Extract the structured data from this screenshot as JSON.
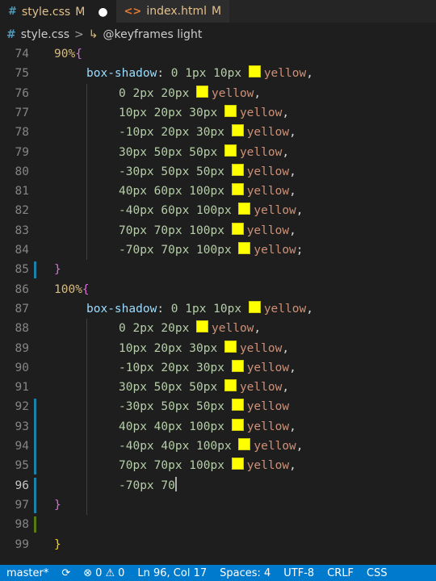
{
  "tabs": [
    {
      "icon": "#",
      "name": "style.css",
      "modified": "M",
      "dirty": "●"
    },
    {
      "icon": "<>",
      "name": "index.html",
      "modified": "M"
    }
  ],
  "breadcrumb": {
    "file": "style.css",
    "separator": ">",
    "symbol": "@keyframes light"
  },
  "swatch_color": "#ffff00",
  "lines": [
    {
      "n": "74",
      "text": "90%{"
    },
    {
      "n": "75",
      "text": "box-shadow: 0 1px 10px yellow,"
    },
    {
      "n": "76",
      "text": "0 2px 20px yellow,"
    },
    {
      "n": "77",
      "text": "10px 20px 30px yellow,"
    },
    {
      "n": "78",
      "text": "-10px 20px 30px yellow,"
    },
    {
      "n": "79",
      "text": "30px 50px 50px yellow,"
    },
    {
      "n": "80",
      "text": "-30px 50px 50px yellow,"
    },
    {
      "n": "81",
      "text": "40px 60px 100px yellow,"
    },
    {
      "n": "82",
      "text": "-40px 60px 100px yellow,"
    },
    {
      "n": "83",
      "text": "70px 70px 100px yellow,"
    },
    {
      "n": "84",
      "text": "-70px 70px 100px yellow;"
    },
    {
      "n": "85",
      "text": "}"
    },
    {
      "n": "86",
      "text": "100%{"
    },
    {
      "n": "87",
      "text": "box-shadow: 0 1px 10px yellow,"
    },
    {
      "n": "88",
      "text": "0 2px 20px yellow,"
    },
    {
      "n": "89",
      "text": "10px 20px 30px yellow,"
    },
    {
      "n": "90",
      "text": "-10px 20px 30px yellow,"
    },
    {
      "n": "91",
      "text": "30px 50px 50px yellow,"
    },
    {
      "n": "92",
      "text": "-30px 50px 50px yellow"
    },
    {
      "n": "93",
      "text": "40px 40px 100px yellow,"
    },
    {
      "n": "94",
      "text": "-40px 40px 100px yellow,"
    },
    {
      "n": "95",
      "text": "70px 70px 100px yellow,"
    },
    {
      "n": "96",
      "text": "-70px 70"
    },
    {
      "n": "97",
      "text": "}"
    },
    {
      "n": "98",
      "text": ""
    },
    {
      "n": "99",
      "text": "}"
    }
  ],
  "status": {
    "branch": "master*",
    "errors": "0",
    "warnings": "0",
    "position": "Ln 96, Col 17",
    "spaces": "Spaces: 4",
    "encoding": "UTF-8",
    "eol": "CRLF",
    "language": "CSS"
  }
}
